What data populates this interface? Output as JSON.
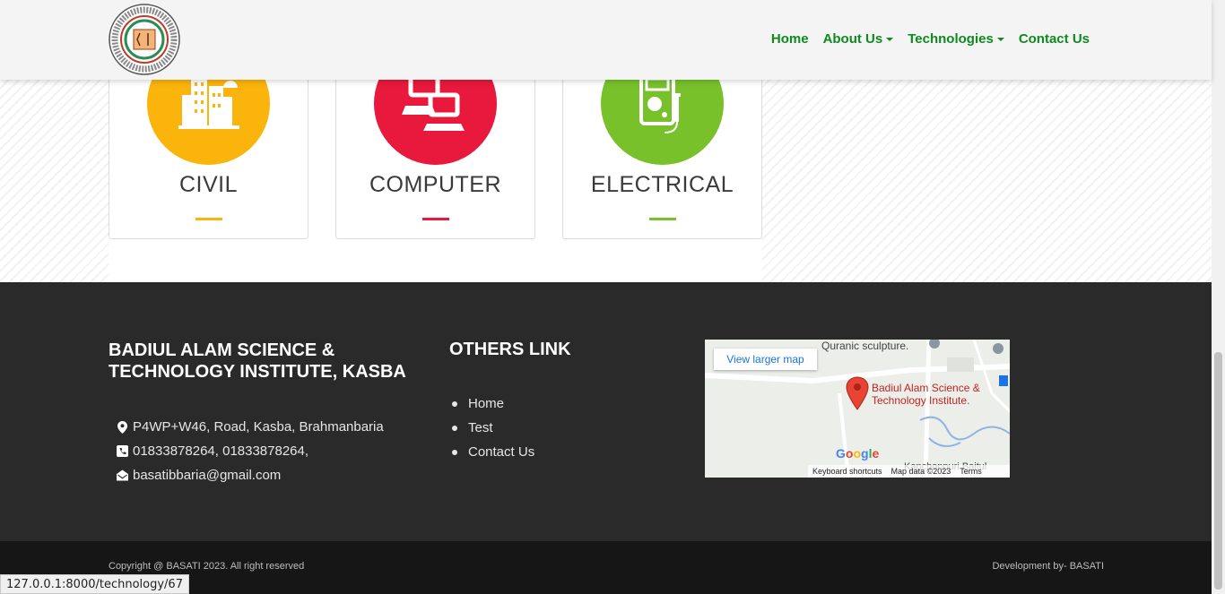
{
  "nav": {
    "items": [
      {
        "label": "Home",
        "dropdown": false
      },
      {
        "label": "About Us",
        "dropdown": true
      },
      {
        "label": "Technologies",
        "dropdown": true
      },
      {
        "label": "Contact Us",
        "dropdown": false
      }
    ]
  },
  "technologies": [
    {
      "label": "CIVIL",
      "color": "#fbb40b",
      "icon": "building-icon"
    },
    {
      "label": "COMPUTER",
      "color": "#e8193c",
      "icon": "computer-icon"
    },
    {
      "label": "ELECTRICAL",
      "color": "#78c12b",
      "icon": "multimeter-icon"
    }
  ],
  "footer": {
    "org_title": "BADIUL ALAM SCIENCE & TECHNOLOGY INSTITUTE, KASBA",
    "address": "P4WP+W46, Road, Kasba, Brahmanbaria",
    "phone": "01833878264, 01833878264,",
    "email": "basatibbaria@gmail.com",
    "links_title": "OTHERS LINK",
    "links": [
      "Home",
      "Test",
      "Contact Us"
    ],
    "map": {
      "view_larger": "View larger map",
      "poi_label": "Quranic sculpture.",
      "place": "Badiul Alam Science & Technology Institute.",
      "bottom_text": "Kanchonpuri Baitul",
      "google": "Google",
      "keyboard": "Keyboard shortcuts",
      "map_data": "Map data ©2023",
      "terms": "Terms"
    }
  },
  "bottom": {
    "copyright": "Copyright @ BASATI 2023. All right reserved",
    "developer": "Development by- BASATI"
  },
  "status_url": "127.0.0.1:8000/technology/67"
}
